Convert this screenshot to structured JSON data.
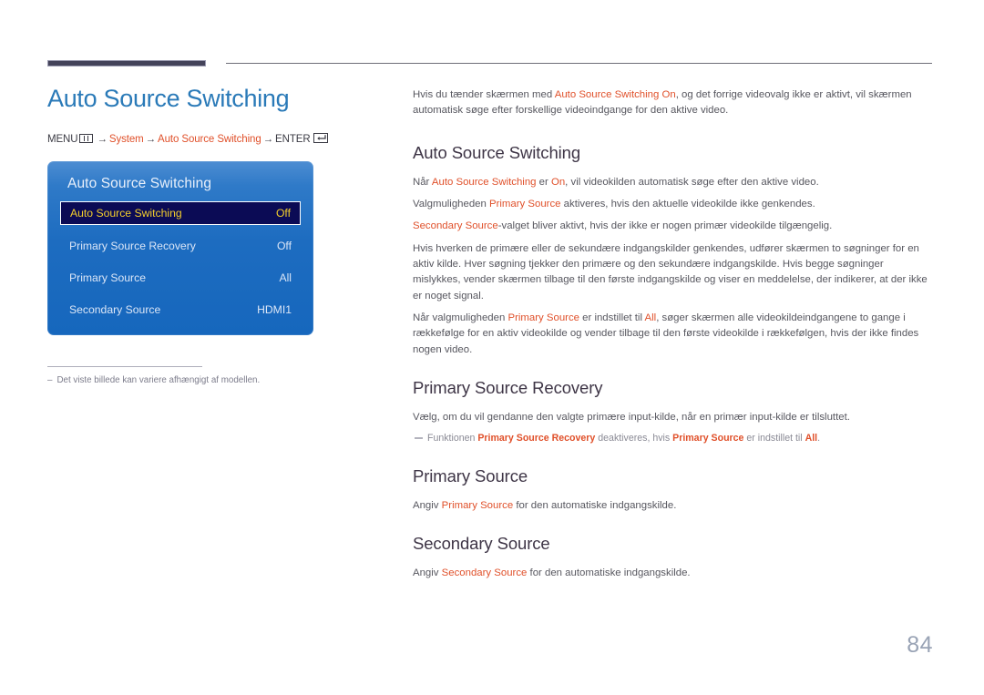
{
  "page_title": "Auto Source Switching",
  "breadcrumb": {
    "menu_label": "MENU",
    "menu_icon": "menu-grid-icon",
    "arrow": "→",
    "item1": "System",
    "item2": "Auto Source Switching",
    "enter_label": "ENTER",
    "enter_icon": "enter-key-icon"
  },
  "osd": {
    "title": "Auto Source Switching",
    "rows": [
      {
        "label": "Auto Source Switching",
        "value": "Off",
        "selected": true
      },
      {
        "label": "Primary Source Recovery",
        "value": "Off",
        "selected": false
      },
      {
        "label": "Primary Source",
        "value": "All",
        "selected": false
      },
      {
        "label": "Secondary Source",
        "value": "HDMI1",
        "selected": false
      }
    ]
  },
  "left_note": {
    "dash": "–",
    "text": "Det viste billede kan variere afhængigt af modellen."
  },
  "intro": {
    "p1_a": "Hvis du tænder skærmen med ",
    "p1_hl": "Auto Source Switching On",
    "p1_b": ", og det forrige videovalg ikke er aktivt, vil skærmen automatisk søge efter forskellige videoindgange for den aktive video."
  },
  "sections": [
    {
      "heading": "Auto Source Switching",
      "paragraphs": [
        {
          "a": "Når ",
          "hl": "Auto Source Switching",
          "b": " er ",
          "hl2": "On",
          "c": ", vil videokilden automatisk søge efter den aktive video."
        },
        {
          "a": "Valgmuligheden ",
          "hl": "Primary Source",
          "b": " aktiveres, hvis den aktuelle videokilde ikke genkendes."
        },
        {
          "hl_lead": "Secondary Source",
          "b": "-valget bliver aktivt, hvis der ikke er nogen primær videokilde tilgængelig."
        },
        {
          "a": "Hvis hverken de primære eller de sekundære indgangskilder genkendes, udfører skærmen to søgninger for en aktiv kilde. Hver søgning tjekker den primære og den sekundære indgangskilde. Hvis begge søgninger mislykkes, vender skærmen tilbage til den første indgangskilde og viser en meddelelse, der indikerer, at der ikke er noget signal."
        },
        {
          "a": "Når valgmuligheden ",
          "hl": "Primary Source",
          "b": " er indstillet til ",
          "hl2": "All",
          "c": ", søger skærmen alle videokildeindgangene to gange i rækkefølge for en aktiv videokilde og vender tilbage til den første videokilde i rækkefølgen, hvis der ikke findes nogen video."
        }
      ]
    },
    {
      "heading": "Primary Source Recovery",
      "paragraph": "Vælg, om du vil gendanne den valgte primære input-kilde, når en primær input-kilde er tilsluttet.",
      "note": {
        "a": "Funktionen ",
        "hl": "Primary Source Recovery",
        "b": " deaktiveres, hvis ",
        "hl2": "Primary Source",
        "c": " er indstillet til ",
        "hl3": "All",
        "d": "."
      }
    },
    {
      "heading": "Primary Source",
      "para": {
        "a": "Angiv ",
        "hl": "Primary Source",
        "b": " for den automatiske indgangskilde."
      }
    },
    {
      "heading": "Secondary Source",
      "para": {
        "a": "Angiv ",
        "hl": "Secondary Source",
        "b": " for den automatiske indgangskilde."
      }
    }
  ],
  "page_number": "84",
  "colors": {
    "title_blue": "#2a7ab8",
    "accent_orange": "#e0502a",
    "heading_dark": "#3e3546",
    "body_gray": "#57575f",
    "osd_blue": "#1d6cc0",
    "osd_selected_navy": "#0b0b55",
    "osd_selected_text": "#f4cf2c",
    "page_num_gray": "#99a3b5"
  }
}
